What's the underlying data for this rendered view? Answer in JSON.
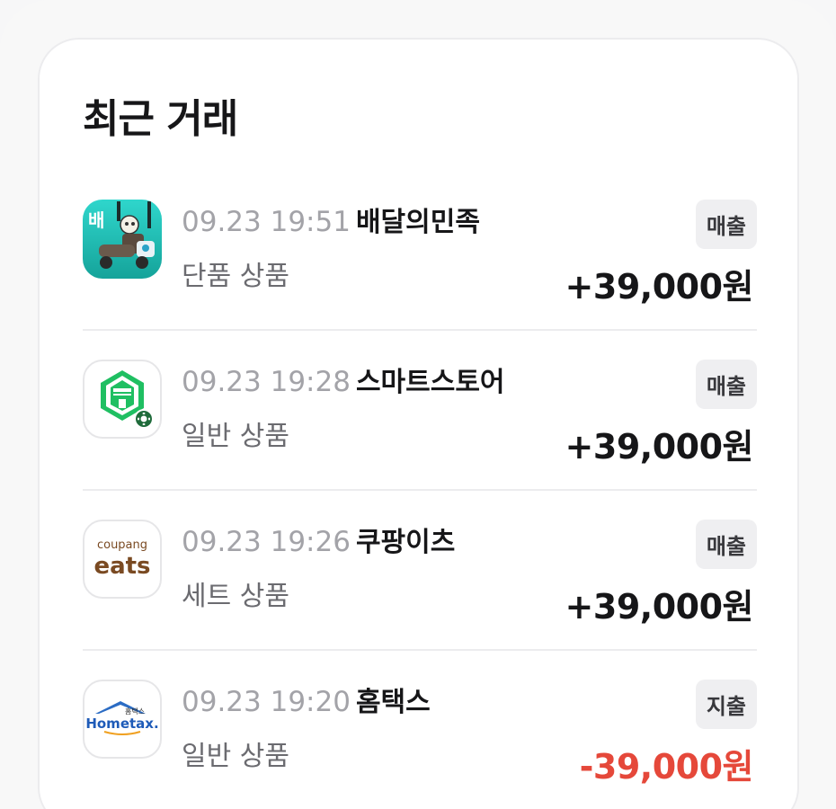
{
  "section_title": "최근 거래",
  "transactions": [
    {
      "time": "09.23 19:51",
      "merchant": "배달의민족",
      "product": "단품 상품",
      "badge": "매출",
      "amount": "+39,000원",
      "icon": "baemin-app-icon",
      "icon_text": "배"
    },
    {
      "time": "09.23 19:28",
      "merchant": "스마트스토어",
      "product": "일반 상품",
      "badge": "매출",
      "amount": "+39,000원",
      "icon": "smartstore-app-icon"
    },
    {
      "time": "09.23 19:26",
      "merchant": "쿠팡이츠",
      "product": "세트 상품",
      "badge": "매출",
      "amount": "+39,000원",
      "icon": "coupangeats-app-icon",
      "icon_text_top": "coupang",
      "icon_text_bottom": "eats"
    },
    {
      "time": "09.23 19:20",
      "merchant": "홈택스",
      "product": "일반 상품",
      "badge": "지출",
      "amount": "-39,000원",
      "icon": "hometax-app-icon",
      "icon_text_small": "홈택스",
      "icon_text_main": "Hometax."
    }
  ],
  "colors": {
    "positive_amount": "#161618",
    "negative_amount": "#e5483a",
    "badge_bg": "#efeff1"
  }
}
